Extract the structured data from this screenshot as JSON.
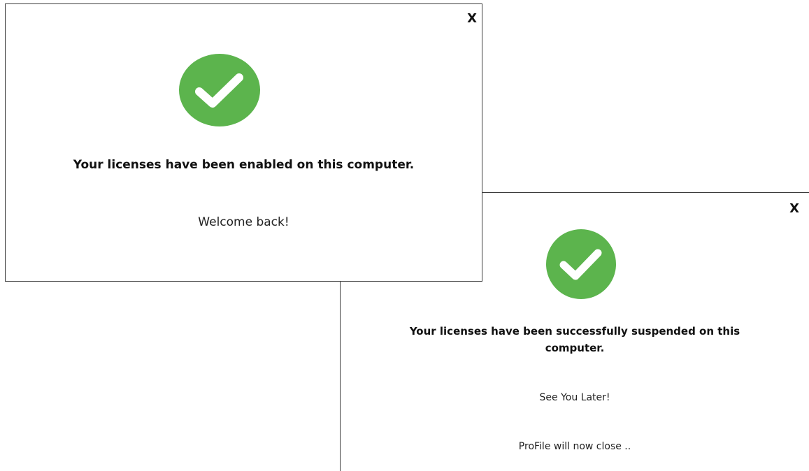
{
  "colors": {
    "success_green": "#5cb44d",
    "check_white": "#ffffff"
  },
  "dialog_enabled": {
    "close_label": "X",
    "icon": "check-circle-icon",
    "title": "Your licenses have been enabled on this computer.",
    "message": "Welcome back!"
  },
  "dialog_suspended": {
    "close_label": "X",
    "icon": "check-circle-icon",
    "title": "Your licenses have been successfully suspended on this computer.",
    "message": "See You Later!",
    "status": "ProFile will now close .."
  }
}
